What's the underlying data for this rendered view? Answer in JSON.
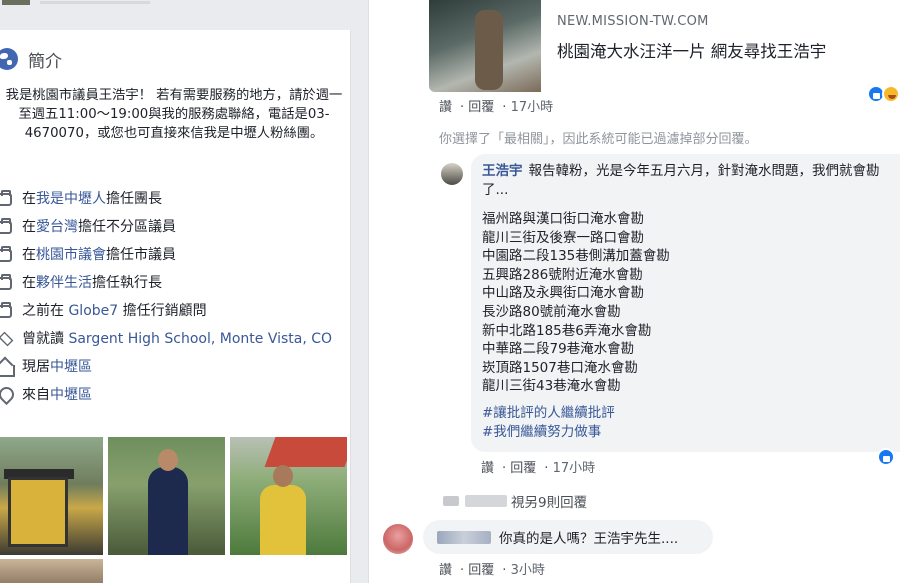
{
  "intro": {
    "title": "簡介",
    "bio": "我是桃園市議員王浩宇！ 若有需要服務的地方，請於週一至週五11:00～19:00與我的服務處聯絡，電話是03-4670070，或您也可直接來信我是中壢人粉絲團。",
    "rows": [
      {
        "icon": "briefcase-icon",
        "prefix": "在",
        "link": "我是中壢人",
        "suffix": "擔任團長"
      },
      {
        "icon": "briefcase-icon",
        "prefix": "在",
        "link": "愛台灣",
        "suffix": "擔任不分區議員"
      },
      {
        "icon": "briefcase-icon",
        "prefix": "在",
        "link": "桃園市議會",
        "suffix": "擔任市議員"
      },
      {
        "icon": "briefcase-icon",
        "prefix": "在",
        "link": "夥伴生活",
        "suffix": "擔任執行長"
      },
      {
        "icon": "briefcase-icon",
        "prefix": "之前在 ",
        "link": "Globe7",
        "suffix": " 擔任行銷顧問"
      },
      {
        "icon": "graduation-cap-icon",
        "prefix": "曾就讀 ",
        "link": "Sargent High School, Monte Vista, CO",
        "suffix": ""
      },
      {
        "icon": "house-icon",
        "prefix": "現居",
        "link": "中壢區",
        "suffix": ""
      },
      {
        "icon": "location-pin-icon",
        "prefix": "來自",
        "link": "中壢區",
        "suffix": ""
      }
    ]
  },
  "feed": {
    "link_preview": {
      "domain": "NEW.MISSION-TW.COM",
      "title": "桃園淹大水汪洋一片 網友尋找王浩宇"
    },
    "post_actions": {
      "like": "讚",
      "reply": "回覆",
      "time": "17小時"
    },
    "filter_notice": "你選擇了「最相關」，因此系統可能已過濾掉部分回覆。",
    "reply": {
      "author": "王浩宇",
      "lead": "報告韓粉，光是今年五月六月，針對淹水問題，我們就會勘了...",
      "items": [
        "福州路與漢口街口淹水會勘",
        "龍川三街及後寮一路口會勘",
        "中園路二段135巷側溝加蓋會勘",
        "五興路286號附近淹水會勘",
        "中山路及永興街口淹水會勘",
        "長沙路80號前淹水會勘",
        "新中北路185巷6弄淹水會勘",
        "中華路二段79巷淹水會勘",
        "崁頂路1507巷口淹水會勘",
        "龍川三街43巷淹水會勘"
      ],
      "tags": [
        "#讓批評的人繼續批評",
        "#我們繼續努力做事"
      ],
      "actions": {
        "like": "讚",
        "reply": "回覆",
        "time": "17小時"
      }
    },
    "more_replies": "視另9則回覆",
    "comment2": {
      "text": "你真的是人嗎？王浩宇先生....",
      "actions": {
        "like": "讚",
        "reply": "回覆",
        "time": "3小時"
      }
    }
  }
}
